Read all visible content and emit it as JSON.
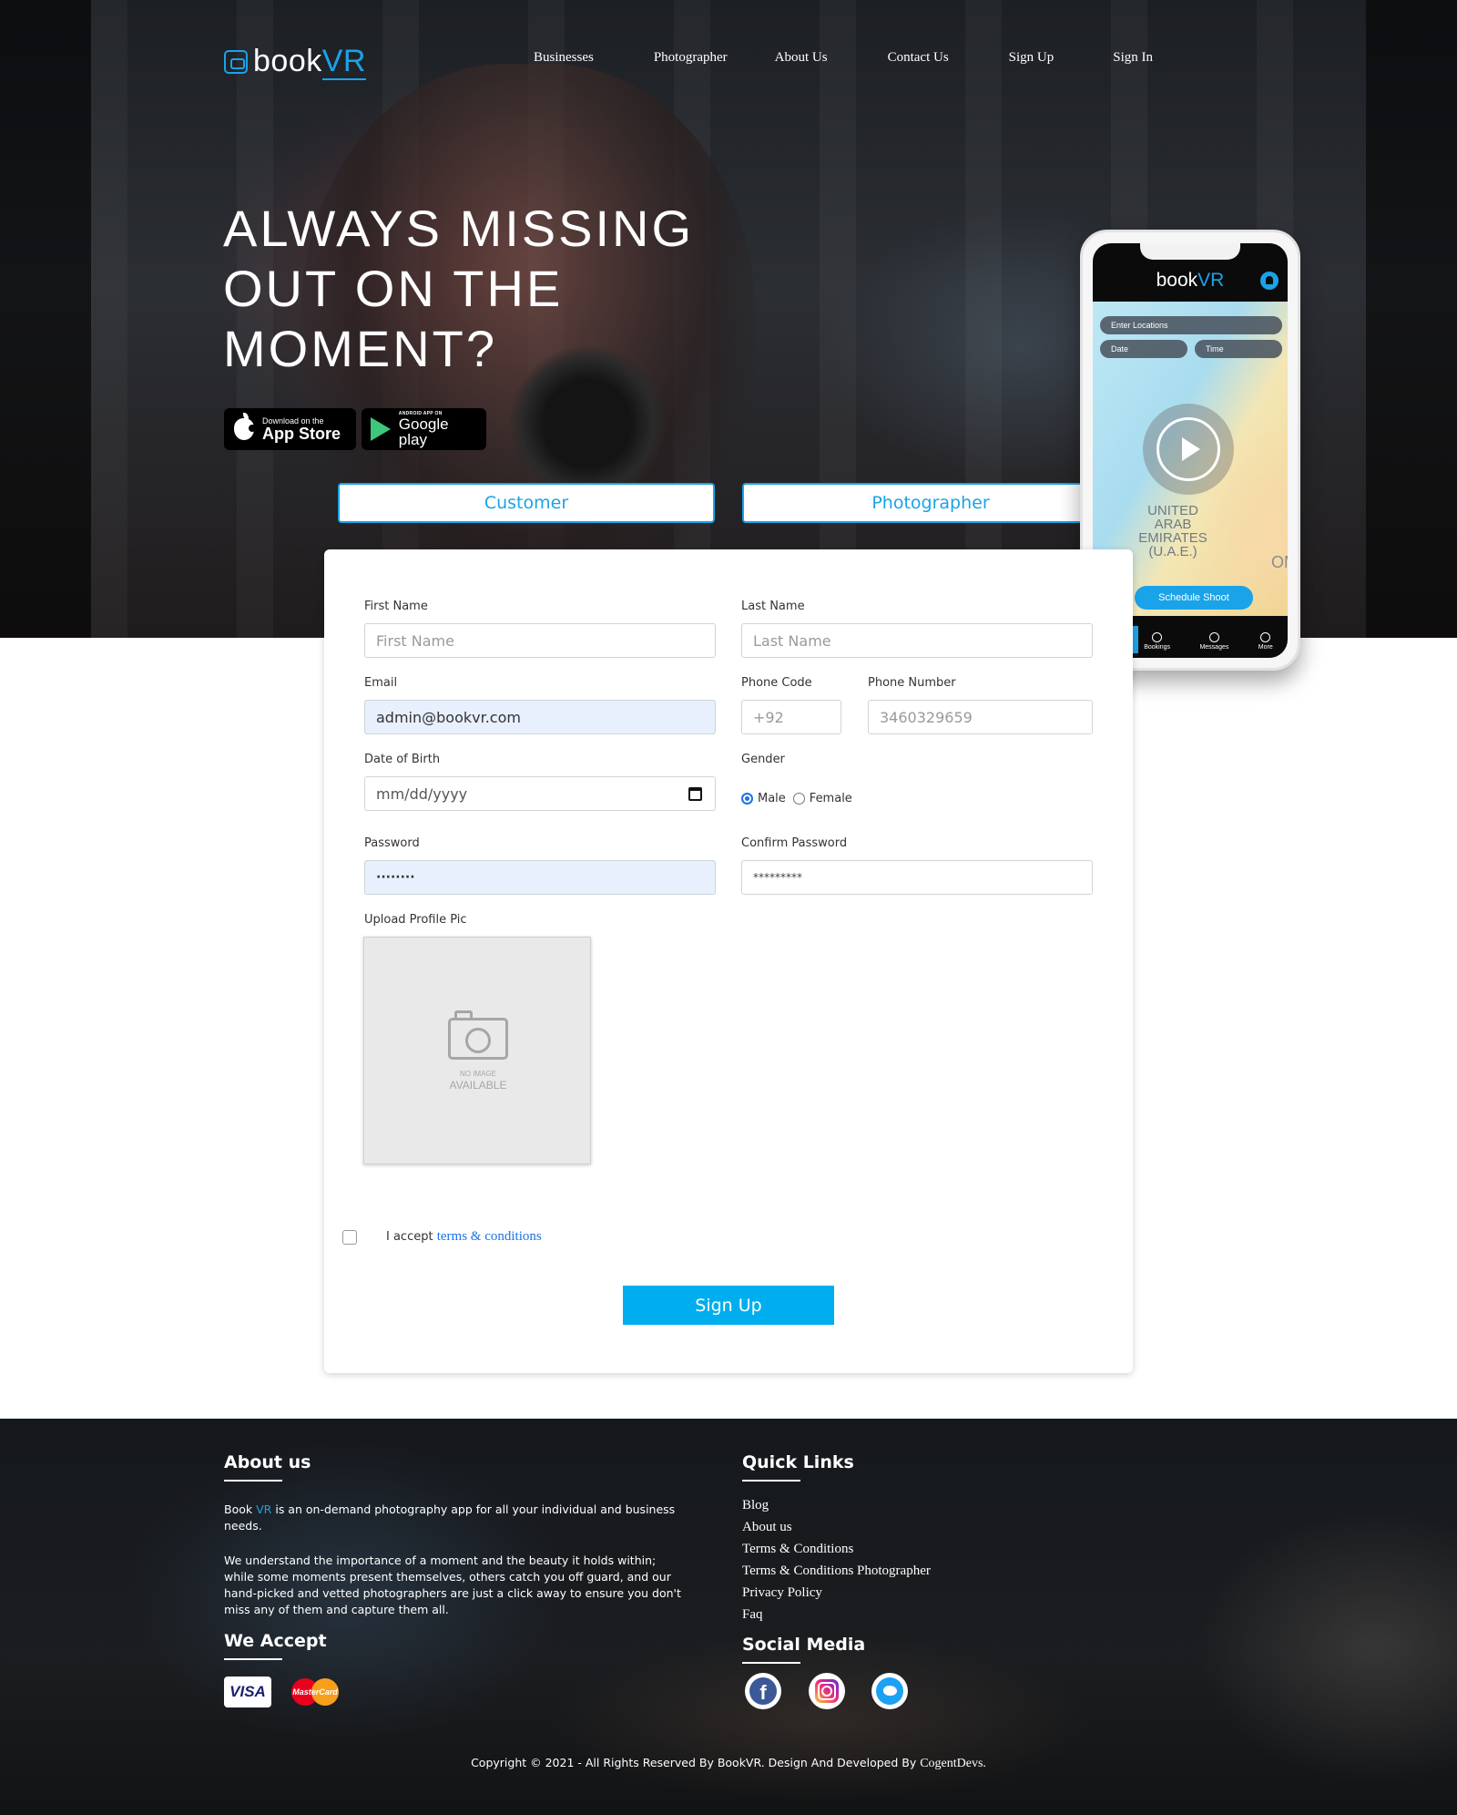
{
  "brand": {
    "name_prefix": "book",
    "name_suffix": "VR"
  },
  "nav": {
    "items": [
      "Businesses",
      "Photographer",
      "About Us",
      "Contact Us",
      "Sign Up",
      "Sign In"
    ]
  },
  "hero": {
    "headline": "ALWAYS MISSING OUT ON THE MOMENT?",
    "app_store": {
      "small": "Download on the",
      "big": "App Store"
    },
    "google_play": {
      "small": "ANDROID APP ON",
      "big": "Google play"
    }
  },
  "role_tabs": {
    "customer": "Customer",
    "photographer": "Photographer"
  },
  "phone_mock": {
    "brand_prefix": "book",
    "brand_suffix": "VR",
    "location_placeholder": "Enter Locations",
    "date_label": "Date",
    "time_label": "Time",
    "country_label": "UNITED ARAB EMIRATES (U.A.E.)",
    "country_partial": "OM",
    "cta": "Schedule Shoot",
    "nav": [
      "Bookings",
      "Messages",
      "More"
    ]
  },
  "form": {
    "first_name": {
      "label": "First Name",
      "placeholder": "First Name",
      "value": ""
    },
    "last_name": {
      "label": "Last Name",
      "placeholder": "Last Name",
      "value": ""
    },
    "email": {
      "label": "Email",
      "value": "admin@bookvr.com"
    },
    "phone_code": {
      "label": "Phone Code",
      "placeholder": "+92"
    },
    "phone_number": {
      "label": "Phone Number",
      "placeholder": "3460329659"
    },
    "dob": {
      "label": "Date of Birth",
      "placeholder": "mm/dd/yyyy"
    },
    "gender": {
      "label": "Gender",
      "options": [
        "Male",
        "Female"
      ],
      "selected": "Male"
    },
    "password": {
      "label": "Password",
      "value": "········"
    },
    "confirm_password": {
      "label": "Confirm Password",
      "value": "*********"
    },
    "upload": {
      "label": "Upload Profile Pic",
      "no_image_small": "NO IMAGE",
      "no_image_big": "AVAILABLE"
    },
    "terms": {
      "prefix": "I accept",
      "link": "terms & conditions",
      "checked": false
    },
    "submit": "Sign Up"
  },
  "footer": {
    "about": {
      "title": "About us",
      "para1_prefix": "Book",
      "para1_brand": "VR",
      "para1_rest": "is an on-demand photography app for all your individual and business needs.",
      "para2": "We understand the importance of a moment and the beauty it holds within; while some moments present themselves, others catch you off guard, and our hand-picked and vetted photographers are just a click away to ensure you don't miss any of them and capture them all."
    },
    "we_accept": {
      "title": "We Accept",
      "visa": "VISA",
      "mastercard": "MasterCard"
    },
    "quick_links": {
      "title": "Quick Links",
      "items": [
        "Blog",
        "About us",
        "Terms & Conditions",
        "Terms & Conditions Photographer",
        "Privacy Policy",
        "Faq"
      ]
    },
    "social": {
      "title": "Social Media",
      "icons": [
        "facebook-icon",
        "instagram-icon",
        "twitter-icon"
      ]
    },
    "copyright": "Copyright © 2021 - All Rights Reserved By BookVR. Design And Developed By",
    "developer": "CogentDevs."
  },
  "colors": {
    "accent": "#1aa3e8",
    "button": "#00aeef",
    "autofill": "#e8f0fe"
  }
}
